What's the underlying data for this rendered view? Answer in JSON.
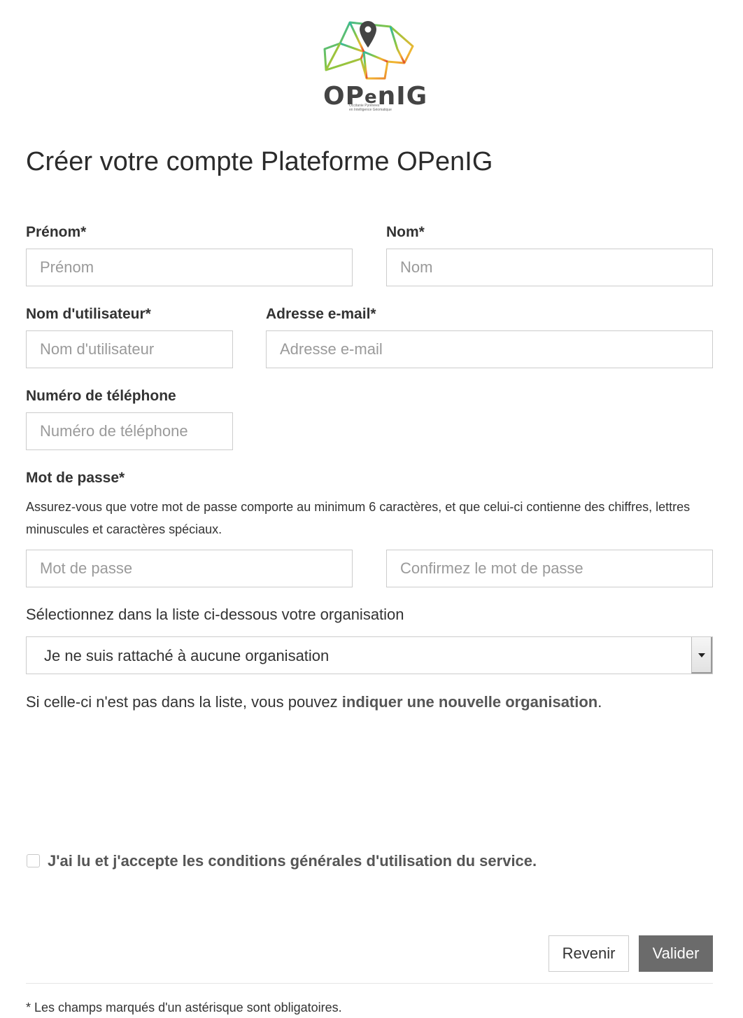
{
  "logo": {
    "text_part1": "OP",
    "text_part2": "e",
    "text_part3": "nIG",
    "tagline": [
      "Occitanie Pyrénées",
      "en Intelligence Géomatique"
    ],
    "icon": "map-pin-polygon-icon",
    "colors": {
      "teal": "#2bb7a6",
      "green": "#8cc63f",
      "yellow": "#f2b632",
      "red": "#e0442e",
      "pin": "#444444"
    }
  },
  "page": {
    "title": "Créer votre compte Plateforme OPenIG"
  },
  "form": {
    "first_name": {
      "label": "Prénom*",
      "placeholder": "Prénom",
      "value": ""
    },
    "last_name": {
      "label": "Nom*",
      "placeholder": "Nom",
      "value": ""
    },
    "username": {
      "label": "Nom d'utilisateur*",
      "placeholder": "Nom d'utilisateur",
      "value": ""
    },
    "email": {
      "label": "Adresse e-mail*",
      "placeholder": "Adresse e-mail",
      "value": ""
    },
    "phone": {
      "label": "Numéro de téléphone",
      "placeholder": "Numéro de téléphone",
      "value": ""
    },
    "password": {
      "label": "Mot de passe*",
      "hint": "Assurez-vous que votre mot de passe comporte au minimum 6 caractères, et que celui-ci contienne des chiffres, lettres minuscules et caractères spéciaux.",
      "placeholder": "Mot de passe",
      "confirm_placeholder": "Confirmez le mot de passe"
    },
    "organisation": {
      "label": "Sélectionnez dans la liste ci-dessous votre organisation",
      "selected": "Je ne suis rattaché à aucune organisation",
      "note_prefix": "Si celle-ci n'est pas dans la liste, vous pouvez ",
      "note_link": "indiquer une nouvelle organisation",
      "note_suffix": "."
    },
    "terms": {
      "label": "J'ai lu et j'accepte les conditions générales d'utilisation du service.",
      "checked": false
    },
    "buttons": {
      "back": "Revenir",
      "submit": "Valider"
    },
    "footnote": "* Les champs marqués d'un astérisque sont obligatoires."
  }
}
